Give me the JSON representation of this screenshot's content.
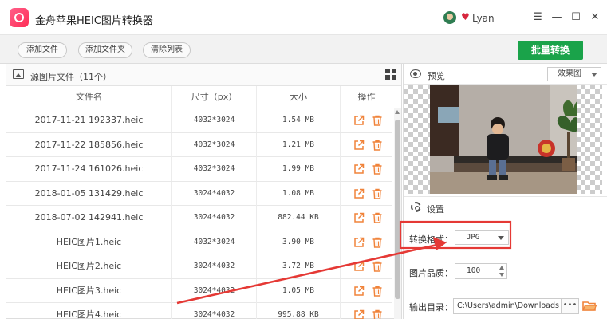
{
  "window": {
    "title": "金舟苹果HEIC图片转换器",
    "user_name": "Lyan",
    "controls": [
      "☰",
      "—",
      "☐",
      "✕"
    ]
  },
  "toolbar": {
    "add_file": "添加文件",
    "add_folder": "添加文件夹",
    "clear_list": "清除列表",
    "batch_convert": "批量转换"
  },
  "file_list": {
    "title": "源图片文件（11个）",
    "columns": [
      "文件名",
      "尺寸（px）",
      "大小",
      "操作"
    ],
    "rows": [
      {
        "name": "2017-11-21 192337.heic",
        "dimensions": "4032*3024",
        "size": "1.54 MB"
      },
      {
        "name": "2017-11-22 185856.heic",
        "dimensions": "4032*3024",
        "size": "1.21 MB"
      },
      {
        "name": "2017-11-24 161026.heic",
        "dimensions": "4032*3024",
        "size": "1.99 MB"
      },
      {
        "name": "2018-01-05 131429.heic",
        "dimensions": "3024*4032",
        "size": "1.08 MB"
      },
      {
        "name": "2018-07-02 142941.heic",
        "dimensions": "3024*4032",
        "size": "882.44 KB"
      },
      {
        "name": "HEIC图片1.heic",
        "dimensions": "4032*3024",
        "size": "3.90 MB"
      },
      {
        "name": "HEIC图片2.heic",
        "dimensions": "3024*4032",
        "size": "3.72 MB"
      },
      {
        "name": "HEIC图片3.heic",
        "dimensions": "3024*4032",
        "size": "1.05 MB"
      },
      {
        "name": "HEIC图片4.heic",
        "dimensions": "3024*4032",
        "size": "995.88 KB"
      }
    ]
  },
  "preview": {
    "label": "预览",
    "view_mode": "效果图"
  },
  "settings": {
    "label": "设置",
    "format_label": "转换格式：",
    "format_value": "JPG",
    "quality_label": "图片品质：",
    "quality_value": "100",
    "output_label": "输出目录：",
    "output_value": "C:\\Users\\admin\\Downloads",
    "browse_label": "•••"
  },
  "colors": {
    "accent": "#1aa34a",
    "action_orange": "#f0833a",
    "annotation_red": "#e53935"
  }
}
